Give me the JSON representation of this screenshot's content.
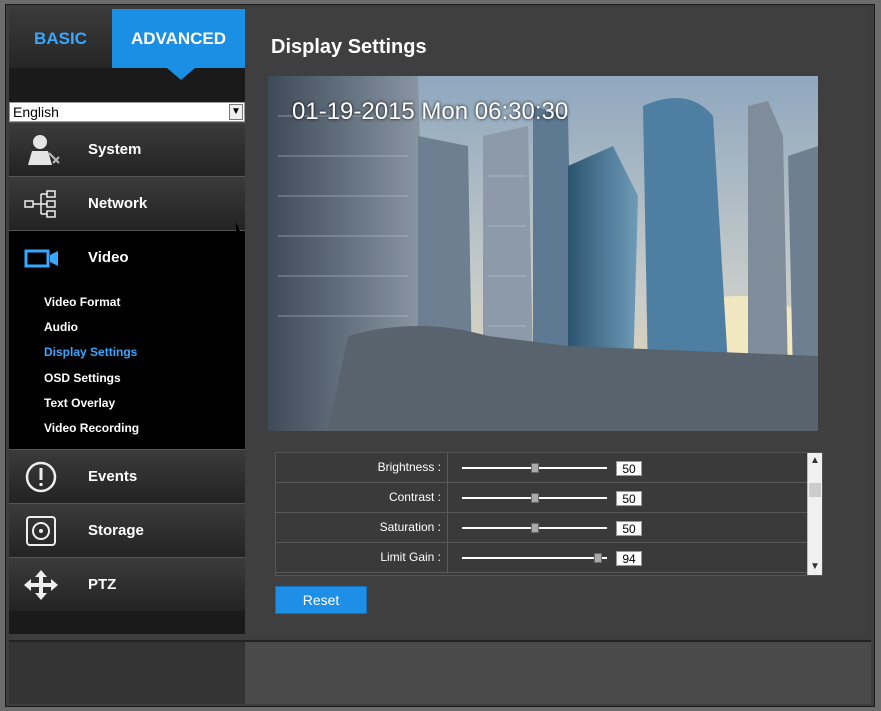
{
  "nav": {
    "basic_tab": "BASIC",
    "advanced_tab": "ADVANCED",
    "language": "English",
    "items": [
      {
        "label": "System",
        "icon": "system-icon"
      },
      {
        "label": "Network",
        "icon": "network-icon"
      },
      {
        "label": "Video",
        "icon": "video-camera-icon"
      },
      {
        "label": "Events",
        "icon": "events-icon"
      },
      {
        "label": "Storage",
        "icon": "storage-icon"
      },
      {
        "label": "PTZ",
        "icon": "ptz-icon"
      }
    ],
    "video_sub": [
      {
        "label": "Video Format",
        "active": false
      },
      {
        "label": "Audio",
        "active": false
      },
      {
        "label": "Display Settings",
        "active": true
      },
      {
        "label": "OSD Settings",
        "active": false
      },
      {
        "label": "Text Overlay",
        "active": false
      },
      {
        "label": "Video Recording",
        "active": false
      }
    ]
  },
  "main": {
    "title": "Display Settings",
    "timestamp": "01-19-2015  Mon 06:30:30",
    "settings": [
      {
        "label": "Brightness :",
        "value": "50",
        "level": 0.5
      },
      {
        "label": "Contrast :",
        "value": "50",
        "level": 0.5
      },
      {
        "label": "Saturation :",
        "value": "50",
        "level": 0.5
      },
      {
        "label": "Limit Gain :",
        "value": "94",
        "level": 0.94
      }
    ],
    "reset_label": "Reset"
  },
  "colors": {
    "accent": "#1b8fe3",
    "active_subnav": "#3aa7ff",
    "sidebar": "#1a1a1a"
  }
}
